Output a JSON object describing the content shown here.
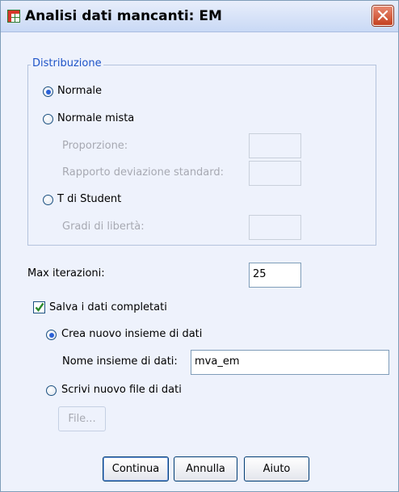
{
  "window": {
    "title": "Analisi dati mancanti: EM"
  },
  "distribution": {
    "legend": "Distribuzione",
    "options": {
      "normal": "Normale",
      "mixed_normal": "Normale mista",
      "student_t": "T di Student"
    },
    "selected": "normal",
    "proportion_label": "Proporzione:",
    "std_ratio_label": "Rapporto deviazione standard:",
    "df_label": "Gradi di libertà:",
    "proportion_value": "",
    "std_ratio_value": "",
    "df_value": ""
  },
  "iterations": {
    "label": "Max iterazioni:",
    "value": "25"
  },
  "save": {
    "checkbox_label": "Salva i dati completati",
    "checked": true,
    "create_dataset_label": "Crea nuovo insieme di dati",
    "dataset_name_label": "Nome insieme di dati:",
    "dataset_name_value": "mva_em",
    "write_file_label": "Scrivi nuovo file di dati",
    "selected": "create_dataset",
    "file_button_label": "File..."
  },
  "buttons": {
    "continue": "Continua",
    "cancel": "Annulla",
    "help": "Aiuto"
  },
  "colors": {
    "dialog_background": "#eef2fc",
    "legend_text": "#1e54c8",
    "disabled_text": "#a7a9b2",
    "close_button": "#c4411f"
  }
}
